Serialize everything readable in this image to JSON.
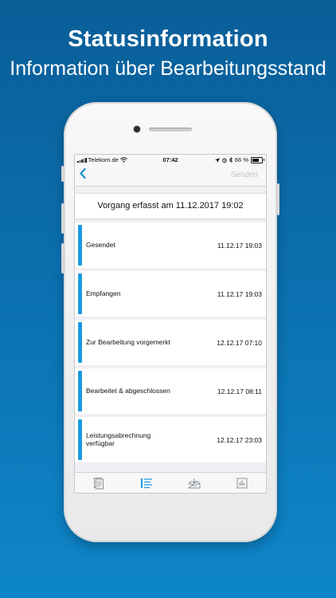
{
  "promo": {
    "headline": "Statusinformation",
    "subline": "Information über Bearbeitungsstand"
  },
  "statusbar": {
    "carrier": "Telekom.de",
    "time": "07:42",
    "battery": "66 %"
  },
  "navbar": {
    "back_icon": "chevron-left-icon",
    "send_label": "Senden"
  },
  "info": {
    "text": "Vorgang erfasst am 11.12.2017 19:02"
  },
  "status_list": [
    {
      "label": "Gesendet",
      "date": "11.12.17 19:03"
    },
    {
      "label": "Empfangen",
      "date": "11.12.17 19:03"
    },
    {
      "label": "Zur Bearbeitung vorgemerkt",
      "date": "12.12.17 07:10"
    },
    {
      "label": "Bearbeitet & abgeschlossen",
      "date": "12.12.17 08:11"
    },
    {
      "label": "Leistungsabrechnung verfügbar",
      "date": "12.12.17 23:03"
    }
  ],
  "tabbar": {
    "tabs": [
      "document-icon",
      "list-icon",
      "inbox-download-icon",
      "chart-icon"
    ],
    "active_index": 1
  },
  "colors": {
    "accent": "#1b9ae0",
    "background_top": "#0a5e98",
    "background_bottom": "#0e86c9"
  }
}
